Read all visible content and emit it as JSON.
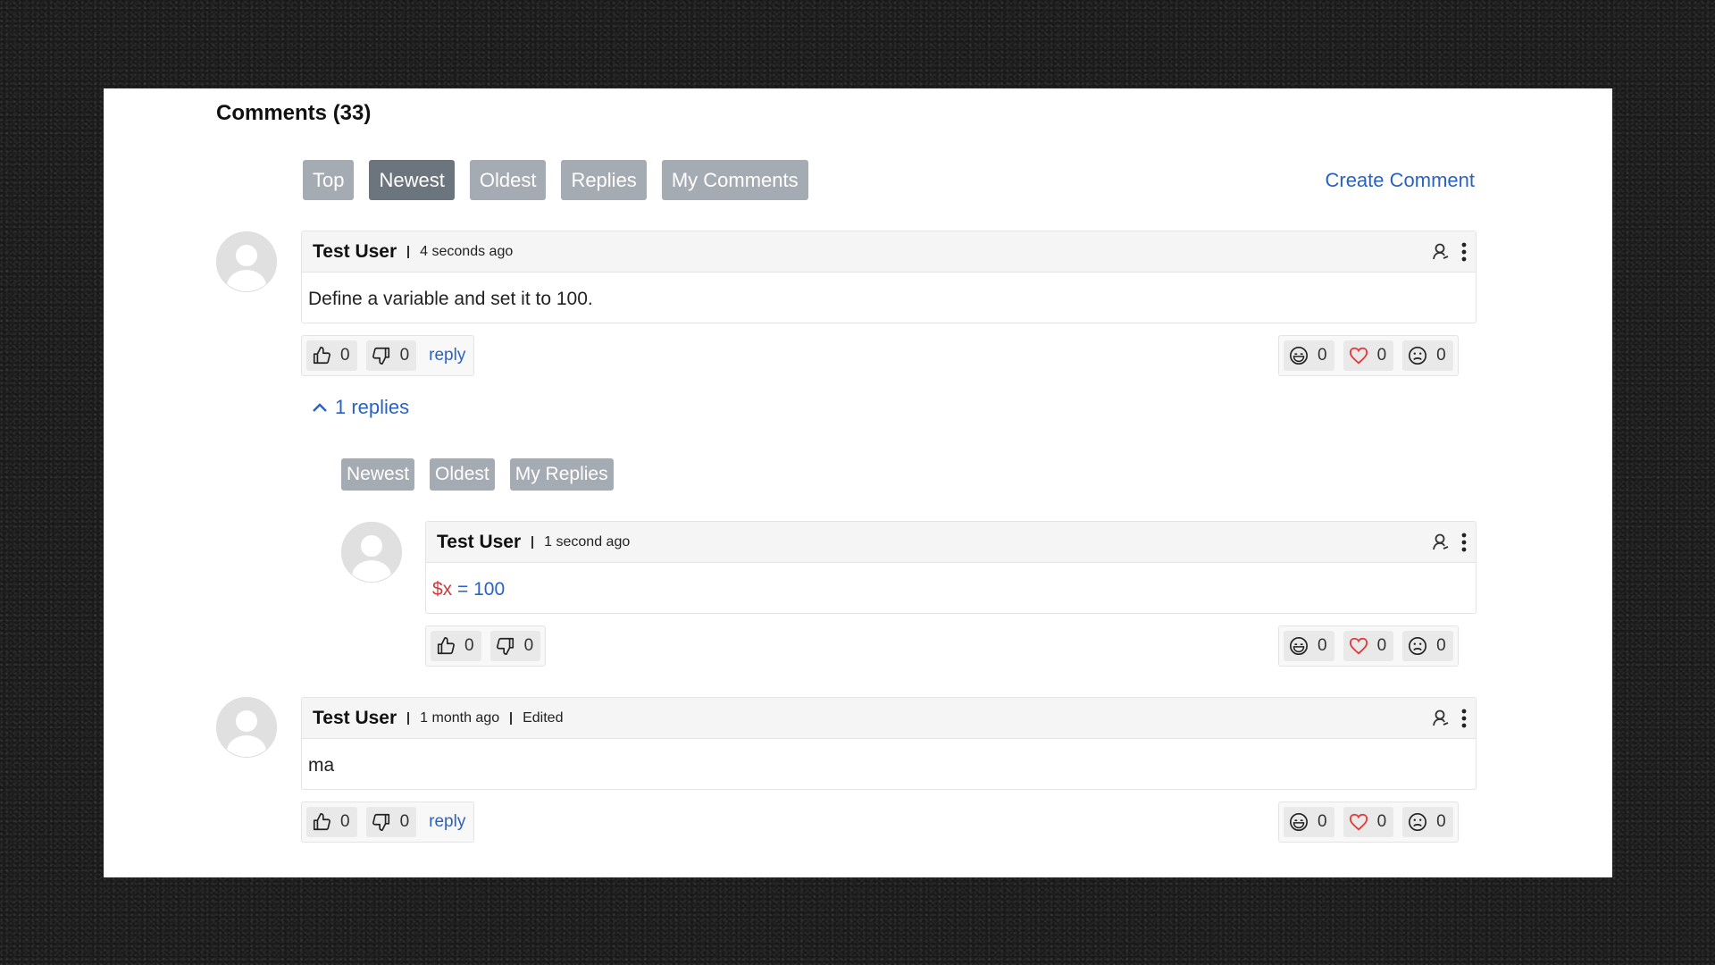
{
  "header": {
    "title": "Comments (33)",
    "create_label": "Create Comment"
  },
  "sort_tabs": [
    {
      "label": "Top",
      "active": false
    },
    {
      "label": "Newest",
      "active": true
    },
    {
      "label": "Oldest",
      "active": false
    },
    {
      "label": "Replies",
      "active": false
    },
    {
      "label": "My Comments",
      "active": false
    }
  ],
  "comments": [
    {
      "author": "Test User",
      "time": "4 seconds ago",
      "text": "Define a variable and set it to 100.",
      "likes": "0",
      "dislikes": "0",
      "reply_label": "reply",
      "reactions": {
        "laugh": "0",
        "love": "0",
        "sad": "0"
      },
      "replies_toggle": "1 replies"
    },
    {
      "author": "Test User",
      "time": "1 month ago",
      "edited": "Edited",
      "text": "ma",
      "likes": "0",
      "dislikes": "0",
      "reply_label": "reply",
      "reactions": {
        "laugh": "0",
        "love": "0",
        "sad": "0"
      }
    }
  ],
  "reply_sort_tabs": [
    {
      "label": "Newest"
    },
    {
      "label": "Oldest"
    },
    {
      "label": "My Replies"
    }
  ],
  "reply": {
    "author": "Test User",
    "time": "1 second ago",
    "code_var": "$x",
    "code_rest": " = 100",
    "likes": "0",
    "dislikes": "0",
    "reactions": {
      "laugh": "0",
      "love": "0",
      "sad": "0"
    }
  },
  "colors": {
    "accent": "#2a62c2",
    "pill": "#a5abb3",
    "pill_active": "#6c757d",
    "heart": "#e23a3a"
  }
}
